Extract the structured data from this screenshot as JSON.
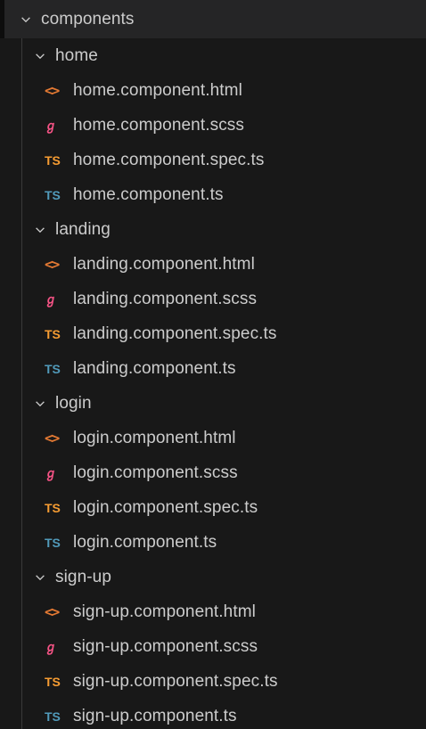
{
  "tree": {
    "root": {
      "label": "components"
    },
    "folders": [
      {
        "name": "home",
        "files": [
          {
            "name": "home.component.html",
            "icon": "html-icon",
            "glyph": "<>"
          },
          {
            "name": "home.component.scss",
            "icon": "scss-icon",
            "glyph": "ℊ"
          },
          {
            "name": "home.component.spec.ts",
            "icon": "ts-spec-icon",
            "glyph": "TS"
          },
          {
            "name": "home.component.ts",
            "icon": "ts-icon",
            "glyph": "TS"
          }
        ]
      },
      {
        "name": "landing",
        "files": [
          {
            "name": "landing.component.html",
            "icon": "html-icon",
            "glyph": "<>"
          },
          {
            "name": "landing.component.scss",
            "icon": "scss-icon",
            "glyph": "ℊ"
          },
          {
            "name": "landing.component.spec.ts",
            "icon": "ts-spec-icon",
            "glyph": "TS"
          },
          {
            "name": "landing.component.ts",
            "icon": "ts-icon",
            "glyph": "TS"
          }
        ]
      },
      {
        "name": "login",
        "files": [
          {
            "name": "login.component.html",
            "icon": "html-icon",
            "glyph": "<>"
          },
          {
            "name": "login.component.scss",
            "icon": "scss-icon",
            "glyph": "ℊ"
          },
          {
            "name": "login.component.spec.ts",
            "icon": "ts-spec-icon",
            "glyph": "TS"
          },
          {
            "name": "login.component.ts",
            "icon": "ts-icon",
            "glyph": "TS"
          }
        ]
      },
      {
        "name": "sign-up",
        "files": [
          {
            "name": "sign-up.component.html",
            "icon": "html-icon",
            "glyph": "<>"
          },
          {
            "name": "sign-up.component.scss",
            "icon": "scss-icon",
            "glyph": "ℊ"
          },
          {
            "name": "sign-up.component.spec.ts",
            "icon": "ts-spec-icon",
            "glyph": "TS"
          },
          {
            "name": "sign-up.component.ts",
            "icon": "ts-icon",
            "glyph": "TS"
          }
        ]
      }
    ]
  },
  "colors": {
    "background": "#181818",
    "root_row": "#252526",
    "text": "#cccccc",
    "html_icon": "#e37933",
    "scss_icon": "#f55385",
    "ts_spec_icon": "#f69c32",
    "ts_icon": "#519aba"
  }
}
